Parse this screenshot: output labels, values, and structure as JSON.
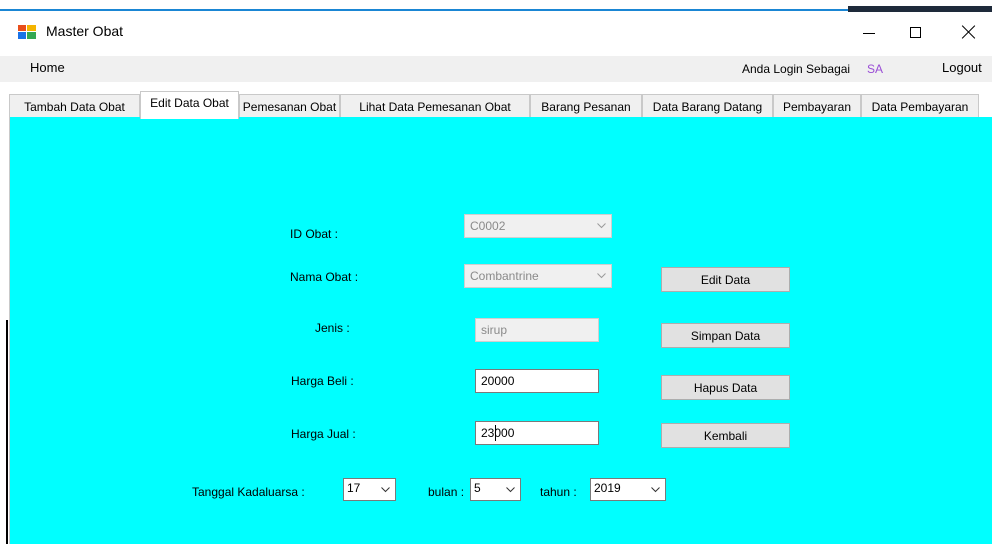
{
  "window": {
    "title": "Master Obat",
    "minimize_icon": "minimize-icon",
    "maximize_icon": "maximize-icon",
    "close_icon": "close-icon"
  },
  "menu": {
    "home": "Home",
    "login_label": "Anda Login Sebagai",
    "login_user": "SA",
    "logout": "Logout"
  },
  "tabs": [
    "Tambah Data Obat",
    "Edit Data Obat",
    "Pemesanan Obat",
    "Lihat Data Pemesanan Obat",
    "Barang Pesanan",
    "Data Barang Datang",
    "Pembayaran",
    "Data Pembayaran"
  ],
  "active_tab": "Edit Data Obat",
  "form": {
    "id_obat_label": "ID Obat :",
    "id_obat_value": "C0002",
    "nama_obat_label": "Nama Obat :",
    "nama_obat_value": "Combantrine",
    "jenis_label": "Jenis :",
    "jenis_value": "sirup",
    "harga_beli_label": "Harga Beli :",
    "harga_beli_value": "20000",
    "harga_jual_label": "Harga Jual :",
    "harga_jual_value": "23000",
    "tanggal_label": "Tanggal Kadaluarsa :",
    "tanggal_value": "17",
    "bulan_label": "bulan :",
    "bulan_value": "5",
    "tahun_label": "tahun :",
    "tahun_value": "2019"
  },
  "buttons": {
    "edit": "Edit Data",
    "simpan": "Simpan Data",
    "hapus": "Hapus Data",
    "kembali": "Kembali"
  },
  "colors": {
    "panel_background": "#00ffff",
    "login_user": "#9a4dd6"
  }
}
